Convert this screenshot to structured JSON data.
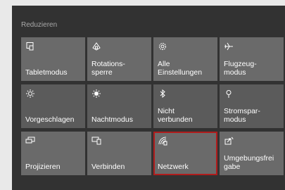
{
  "panel": {
    "collapse_label": "Reduzieren"
  },
  "tiles": [
    {
      "label": "Tabletmodus",
      "icon": "tablet-mode-icon"
    },
    {
      "label": "Rotations-\nsperre",
      "icon": "rotation-lock-icon"
    },
    {
      "label": "Alle\nEinstellungen",
      "icon": "settings-gear-icon"
    },
    {
      "label": "Flugzeug-\nmodus",
      "icon": "airplane-icon"
    },
    {
      "label": "Vorgeschlagen",
      "icon": "brightness-icon"
    },
    {
      "label": "Nachtmodus",
      "icon": "night-light-icon"
    },
    {
      "label": "Nicht\nverbunden",
      "icon": "bluetooth-icon"
    },
    {
      "label": "Stromspar-\nmodus",
      "icon": "battery-saver-icon"
    },
    {
      "label": "Projizieren",
      "icon": "project-icon"
    },
    {
      "label": "Verbinden",
      "icon": "connect-icon"
    },
    {
      "label": "Netzwerk",
      "icon": "network-icon"
    },
    {
      "label": "Umgebungsfreigabe",
      "label_display": "Umgebungsfrei\ngabe",
      "icon": "nearby-sharing-icon"
    }
  ],
  "colors": {
    "tile": "#6a6a6a",
    "tile_dark": "#5b5b5b",
    "panel": "#323232",
    "highlight": "#b01c1c"
  }
}
